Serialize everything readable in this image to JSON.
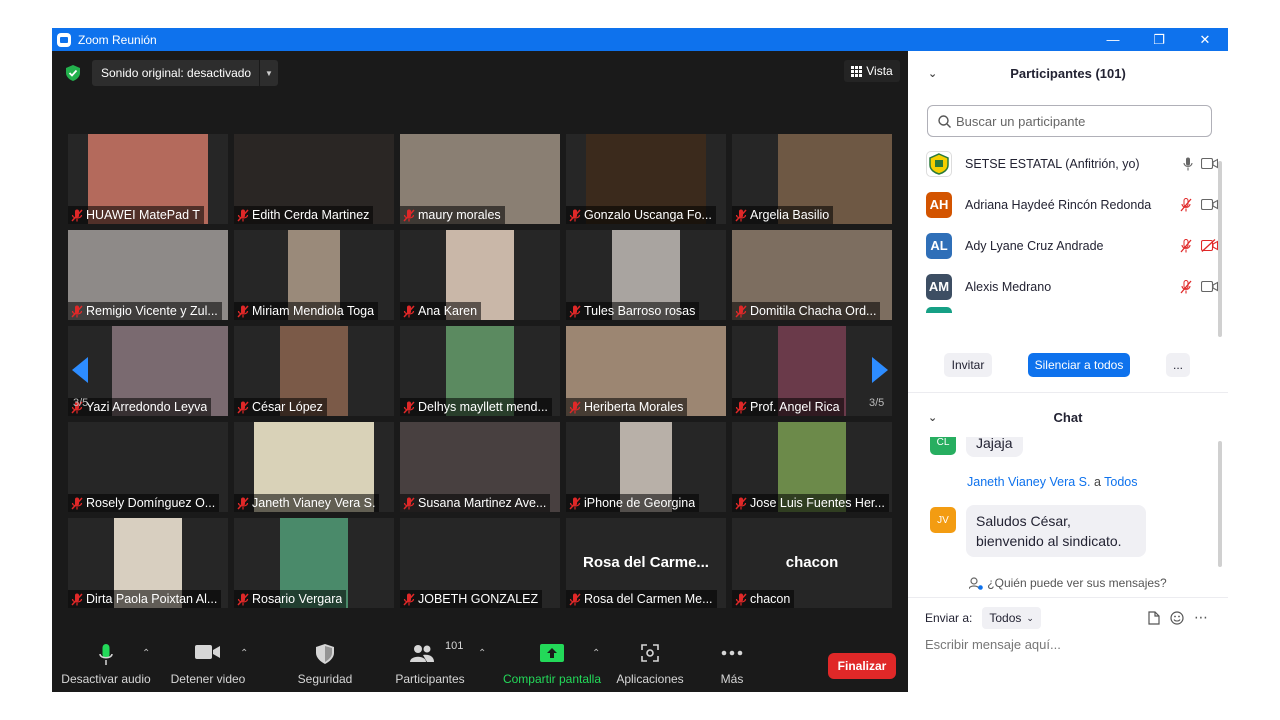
{
  "window": {
    "title": "Zoom Reunión"
  },
  "topbar": {
    "sound_label": "Sonido original: desactivado",
    "view_label": "Vista"
  },
  "gallery": {
    "page": "3/5",
    "tiles": [
      {
        "name": "HUAWEI MatePad T",
        "bg": "#b46a5c"
      },
      {
        "name": "Edith Cerda Martinez",
        "bg": "#2a2624"
      },
      {
        "name": "maury morales",
        "bg": "#8a7f73"
      },
      {
        "name": "Gonzalo Uscanga Fo...",
        "bg": "#3b2a1c"
      },
      {
        "name": "Argelia Basilio",
        "bg": "#6e5844"
      },
      {
        "name": "Remigio Vicente y Zul...",
        "bg": "#8e8a88"
      },
      {
        "name": "Miriam Mendiola Toga",
        "bg": "#9a8a7a"
      },
      {
        "name": "Ana Karen",
        "bg": "#c9b7a8"
      },
      {
        "name": "Tules Barroso rosas",
        "bg": "#a9a4a0"
      },
      {
        "name": "Domitila Chacha Ord...",
        "bg": "#7d6e60"
      },
      {
        "name": "Yazi Arredondo Leyva",
        "bg": "#7a6a70"
      },
      {
        "name": "César López",
        "bg": "#7b5a48"
      },
      {
        "name": "Delhys mayllett mend...",
        "bg": "#5b8a60"
      },
      {
        "name": "Heriberta Morales",
        "bg": "#9c8672"
      },
      {
        "name": "Prof. Angel Rica",
        "bg": "#6a3a4a"
      },
      {
        "name": "Rosely Domínguez O...",
        "bg": ""
      },
      {
        "name": "Janeth Vianey Vera S.",
        "bg": "#d9d2b8"
      },
      {
        "name": "Susana Martinez Ave...",
        "bg": "#484040"
      },
      {
        "name": "iPhone de Georgina",
        "bg": "#b8b0a8"
      },
      {
        "name": "Jose Luis Fuentes Her...",
        "bg": "#6c8a4a"
      },
      {
        "name": "Dirta Paola Poixtan Al...",
        "bg": "#d8cfc0"
      },
      {
        "name": "Rosario Vergara",
        "bg": "#4a8a6a"
      },
      {
        "name": "JOBETH GONZALEZ",
        "bg": "",
        "big": ""
      },
      {
        "name": "Rosa del Carmen Me...",
        "bg": "",
        "big": "Rosa del Carme..."
      },
      {
        "name": "chacon",
        "bg": "",
        "big": "chacon"
      }
    ]
  },
  "toolbar": {
    "audio": "Desactivar audio",
    "video": "Detener video",
    "security": "Seguridad",
    "participants": "Participantes",
    "participants_count": "101",
    "share": "Compartir pantalla",
    "apps": "Aplicaciones",
    "more": "Más",
    "end": "Finalizar"
  },
  "participants_panel": {
    "title": "Participantes (101)",
    "search_placeholder": "Buscar un participante",
    "items": [
      {
        "initials": "",
        "name": "SETSE ESTATAL (Anfitrión, yo)",
        "color": "#ffffff"
      },
      {
        "initials": "AH",
        "name": "Adriana Haydeé Rincón Redonda",
        "color": "#d35400"
      },
      {
        "initials": "AL",
        "name": "Ady Lyane Cruz Andrade",
        "color": "#2f6fb8"
      },
      {
        "initials": "AM",
        "name": "Alexis Medrano",
        "color": "#3d4e63"
      }
    ],
    "invite": "Invitar",
    "mute_all": "Silenciar a todos",
    "more": "..."
  },
  "chat_panel": {
    "title": "Chat",
    "messages": [
      {
        "initials": "CL",
        "color": "#27ae60",
        "text": "Jajaja"
      },
      {
        "initials": "JV",
        "color": "#f39c12",
        "sender": "Janeth Vianey Vera S.",
        "to_word": "a",
        "to": "Todos",
        "line1": "Saludos César,",
        "line2": "bienvenido al sindicato."
      }
    ],
    "who_sees": "¿Quién puede ver sus mensajes?",
    "send_to_label": "Enviar a:",
    "send_to_value": "Todos",
    "input_placeholder": "Escribir mensaje aquí..."
  },
  "colors": {
    "zoom_blue": "#0e72ed",
    "end_red": "#e02828",
    "share_green": "#23d959",
    "muted_red": "#e02828"
  }
}
